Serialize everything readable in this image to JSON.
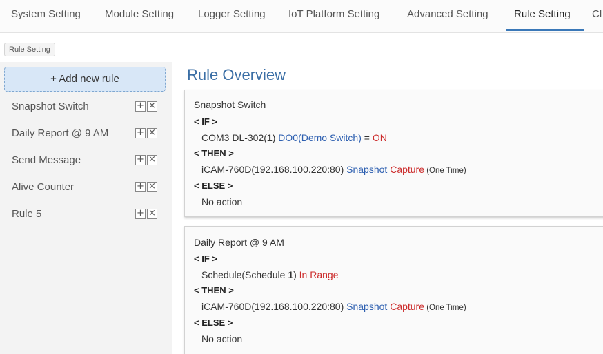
{
  "nav": {
    "tabs": [
      {
        "label": "System Setting"
      },
      {
        "label": "Module Setting"
      },
      {
        "label": "Logger Setting"
      },
      {
        "label": "IoT Platform Setting"
      },
      {
        "label": "Advanced Setting"
      },
      {
        "label": "Rule Setting"
      },
      {
        "label": "Cl"
      }
    ],
    "active": "Rule Setting"
  },
  "breadcrumb": "Rule Setting",
  "sidebar": {
    "add_button": "+ Add new rule",
    "items": [
      {
        "label": "Snapshot Switch"
      },
      {
        "label": "Daily Report @ 9 AM"
      },
      {
        "label": "Send Message"
      },
      {
        "label": "Alive Counter"
      },
      {
        "label": "Rule 5"
      }
    ],
    "add_icon": "+",
    "remove_icon": "×"
  },
  "main": {
    "title": "Rule Overview",
    "keywords": {
      "if": "< IF >",
      "then": "< THEN >",
      "else": "< ELSE >"
    },
    "rules": [
      {
        "name": "Snapshot Switch",
        "if": {
          "prefix": "COM3 DL-302(",
          "num": "1",
          "suffix": ") ",
          "target": "DO0(Demo Switch)",
          "op": " = ",
          "value": "ON"
        },
        "then": {
          "device": "iCAM-760D(192.168.100.220:80) ",
          "action": "Snapshot",
          "effect": " Capture",
          "mode": " (One Time)"
        },
        "else": "No action"
      },
      {
        "name": "Daily Report @ 9 AM",
        "if": {
          "prefix": "Schedule(Schedule ",
          "num": "1",
          "suffix": ") ",
          "target": "",
          "op": "",
          "value": "In Range"
        },
        "then": {
          "device": "iCAM-760D(192.168.100.220:80) ",
          "action": "Snapshot",
          "effect": " Capture",
          "mode": " (One Time)"
        },
        "else": "No action"
      }
    ]
  },
  "colors": {
    "accent": "#3a78b8",
    "title": "#3a6ea5",
    "blue_text": "#2d5fb0",
    "red_text": "#cc2b2b",
    "add_button_bg": "#d8e7f7"
  }
}
